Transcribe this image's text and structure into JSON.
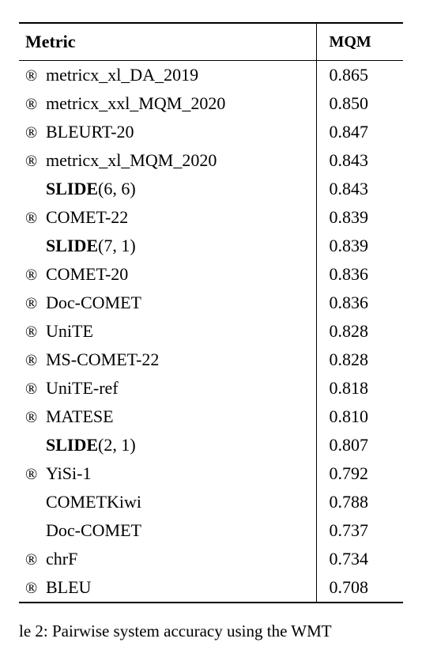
{
  "headers": {
    "metric": "Metric",
    "mqm": "MQM"
  },
  "rows": [
    {
      "reg": true,
      "bold": false,
      "name": "metricx_xl_DA_2019",
      "params": "",
      "mqm": "0.865"
    },
    {
      "reg": true,
      "bold": false,
      "name": "metricx_xxl_MQM_2020",
      "params": "",
      "mqm": "0.850"
    },
    {
      "reg": true,
      "bold": false,
      "name": "BLEURT-20",
      "params": "",
      "mqm": "0.847"
    },
    {
      "reg": true,
      "bold": false,
      "name": "metricx_xl_MQM_2020",
      "params": "",
      "mqm": "0.843"
    },
    {
      "reg": false,
      "bold": true,
      "name": "SLIDE",
      "params": "(6, 6)",
      "mqm": "0.843"
    },
    {
      "reg": true,
      "bold": false,
      "name": "COMET-22",
      "params": "",
      "mqm": "0.839"
    },
    {
      "reg": false,
      "bold": true,
      "name": "SLIDE",
      "params": "(7, 1)",
      "mqm": "0.839"
    },
    {
      "reg": true,
      "bold": false,
      "name": "COMET-20",
      "params": "",
      "mqm": "0.836"
    },
    {
      "reg": true,
      "bold": false,
      "name": "Doc-COMET",
      "params": "",
      "mqm": "0.836"
    },
    {
      "reg": true,
      "bold": false,
      "name": "UniTE",
      "params": "",
      "mqm": "0.828"
    },
    {
      "reg": true,
      "bold": false,
      "name": "MS-COMET-22",
      "params": "",
      "mqm": "0.828"
    },
    {
      "reg": true,
      "bold": false,
      "name": "UniTE-ref",
      "params": "",
      "mqm": "0.818"
    },
    {
      "reg": true,
      "bold": false,
      "name": "MATESE",
      "params": "",
      "mqm": "0.810"
    },
    {
      "reg": false,
      "bold": true,
      "name": "SLIDE",
      "params": "(2, 1)",
      "mqm": "0.807"
    },
    {
      "reg": true,
      "bold": false,
      "name": "YiSi-1",
      "params": "",
      "mqm": "0.792"
    },
    {
      "reg": false,
      "bold": false,
      "name": "COMETKiwi",
      "params": "",
      "mqm": "0.788"
    },
    {
      "reg": false,
      "bold": false,
      "name": "Doc-COMET",
      "params": "",
      "mqm": "0.737"
    },
    {
      "reg": true,
      "bold": false,
      "name": "chrF",
      "params": "",
      "mqm": "0.734"
    },
    {
      "reg": true,
      "bold": false,
      "name": "BLEU",
      "params": "",
      "mqm": "0.708"
    }
  ],
  "caption_prefix": "le 2: Pairwise system accuracy using the WMT",
  "reg_symbol": "®",
  "chart_data": {
    "type": "table",
    "title": "Pairwise system accuracy using the WMT",
    "columns": [
      "Metric",
      "MQM"
    ],
    "series": [
      {
        "name": "metricx_xl_DA_2019",
        "value": 0.865,
        "registered": true
      },
      {
        "name": "metricx_xxl_MQM_2020",
        "value": 0.85,
        "registered": true
      },
      {
        "name": "BLEURT-20",
        "value": 0.847,
        "registered": true
      },
      {
        "name": "metricx_xl_MQM_2020",
        "value": 0.843,
        "registered": true
      },
      {
        "name": "SLIDE(6,6)",
        "value": 0.843,
        "registered": false
      },
      {
        "name": "COMET-22",
        "value": 0.839,
        "registered": true
      },
      {
        "name": "SLIDE(7,1)",
        "value": 0.839,
        "registered": false
      },
      {
        "name": "COMET-20",
        "value": 0.836,
        "registered": true
      },
      {
        "name": "Doc-COMET",
        "value": 0.836,
        "registered": true
      },
      {
        "name": "UniTE",
        "value": 0.828,
        "registered": true
      },
      {
        "name": "MS-COMET-22",
        "value": 0.828,
        "registered": true
      },
      {
        "name": "UniTE-ref",
        "value": 0.818,
        "registered": true
      },
      {
        "name": "MATESE",
        "value": 0.81,
        "registered": true
      },
      {
        "name": "SLIDE(2,1)",
        "value": 0.807,
        "registered": false
      },
      {
        "name": "YiSi-1",
        "value": 0.792,
        "registered": true
      },
      {
        "name": "COMETKiwi",
        "value": 0.788,
        "registered": false
      },
      {
        "name": "Doc-COMET",
        "value": 0.737,
        "registered": false
      },
      {
        "name": "chrF",
        "value": 0.734,
        "registered": true
      },
      {
        "name": "BLEU",
        "value": 0.708,
        "registered": true
      }
    ]
  }
}
